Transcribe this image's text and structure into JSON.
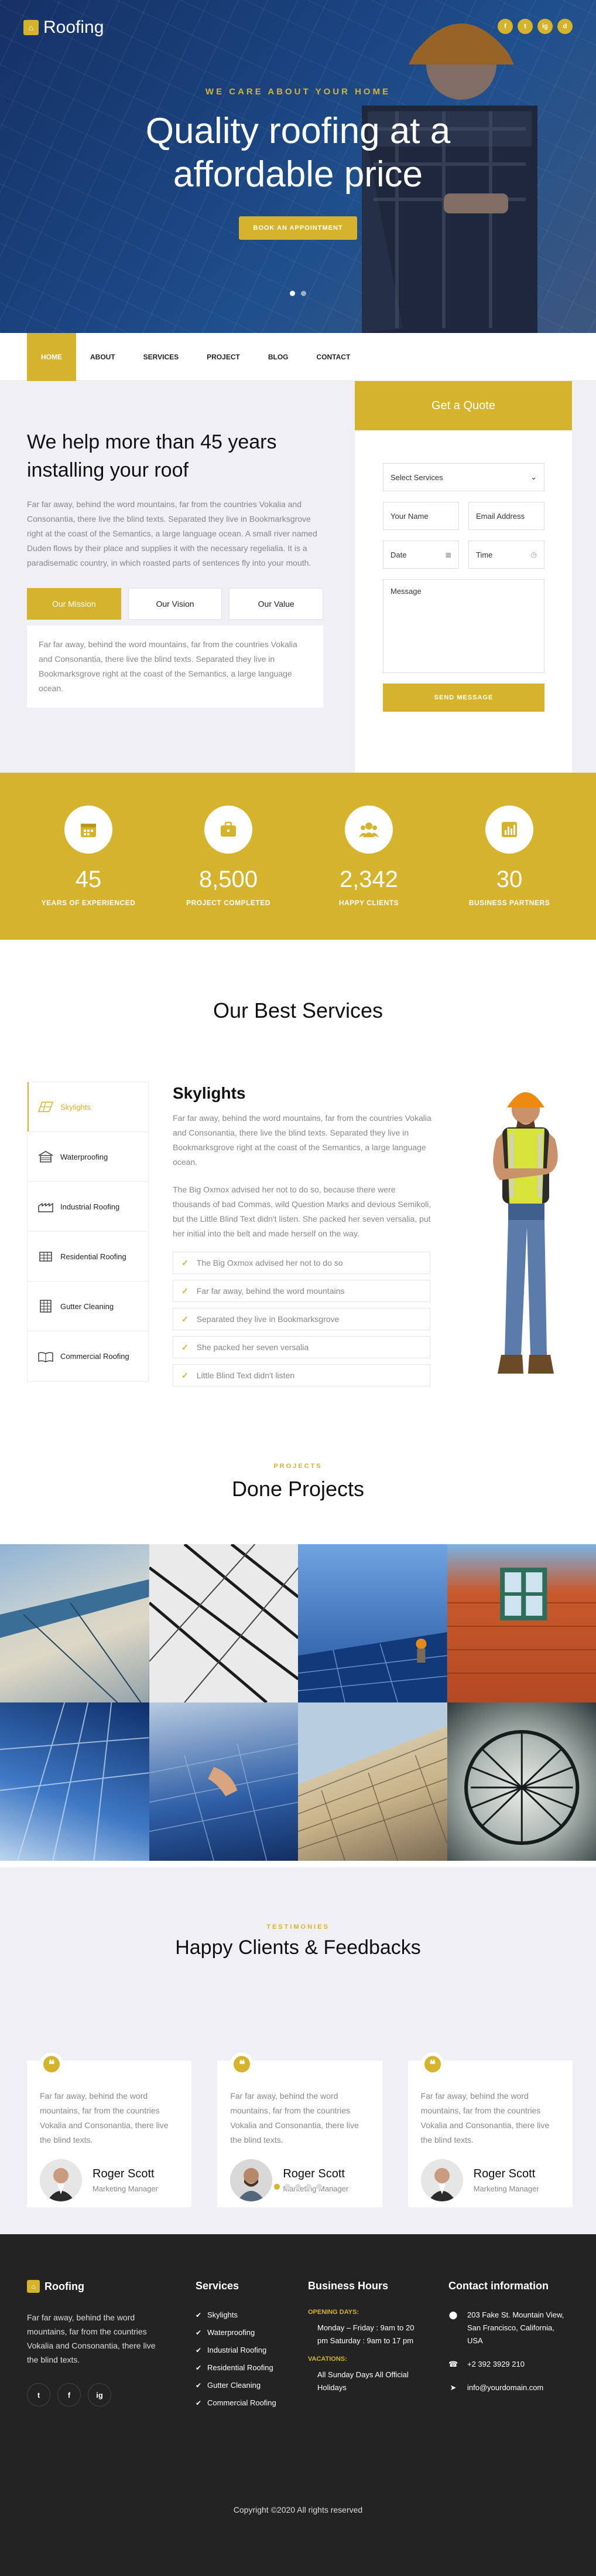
{
  "brand": {
    "name": "Roofing",
    "accent": "#d6b32c",
    "dark": "#232323"
  },
  "hero": {
    "tagline": "WE CARE ABOUT YOUR HOME",
    "title": "Quality roofing at a affordable price",
    "cta": "BOOK AN APPOINTMENT",
    "social": [
      "f",
      "t",
      "ig",
      "d"
    ]
  },
  "nav": {
    "items": [
      "HOME",
      "ABOUT",
      "SERVICES",
      "PROJECT",
      "BLOG",
      "CONTACT"
    ]
  },
  "about": {
    "title": "We help more than 45 years installing your roof",
    "text": "Far far away, behind the word mountains, far from the countries Vokalia and Consonantia, there live the blind texts. Separated they live in Bookmarksgrove right at the coast of the Semantics, a large language ocean. A small river named Duden flows by their place and supplies it with the necessary regelialia. It is a paradisematic country, in which roasted parts of sentences fly into your mouth.",
    "tabs": [
      "Our Mission",
      "Our Vision",
      "Our Value"
    ],
    "tab_text": "Far far away, behind the word mountains, far from the countries Vokalia and Consonantia, there live the blind texts. Separated they live in Bookmarksgrove right at the coast of the Semantics, a large language ocean."
  },
  "quote": {
    "title": "Get a Quote",
    "select": "Select Services",
    "name": "Your Name",
    "email": "Email Address",
    "date": "Date",
    "time": "Time",
    "message": "Message",
    "submit": "SEND MESSAGE"
  },
  "stats": [
    {
      "value": "45",
      "label": "YEARS OF EXPERIENCED",
      "icon": "calendar-icon"
    },
    {
      "value": "8,500",
      "label": "PROJECT COMPLETED",
      "icon": "briefcase-icon"
    },
    {
      "value": "2,342",
      "label": "HAPPY CLIENTS",
      "icon": "users-icon"
    },
    {
      "value": "30",
      "label": "BUSINESS PARTNERS",
      "icon": "chart-icon"
    }
  ],
  "services": {
    "title": "Our Best Services",
    "items": [
      "Skylights",
      "Waterproofing",
      "Industrial Roofing",
      "Residential Roofing",
      "Gutter Cleaning",
      "Commercial Roofing"
    ],
    "heading": "Skylights",
    "p1": "Far far away, behind the word mountains, far from the countries Vokalia and Consonantia, there live the blind texts. Separated they live in Bookmarksgrove right at the coast of the Semantics, a large language ocean.",
    "p2": "The Big Oxmox advised her not to do so, because there were thousands of bad Commas, wild Question Marks and devious Semikoli, but the Little Blind Text didn't listen. She packed her seven versalia, put her initial into the belt and made herself on the way.",
    "checks": [
      "The Big Oxmox advised her not to do so",
      "Far far away, behind the word mountains",
      "Separated they live in Bookmarksgrove",
      "She packed her seven versalia",
      "Little Blind Text didn't listen"
    ]
  },
  "projects": {
    "kicker": "PROJECTS",
    "title": "Done Projects"
  },
  "testimonials": {
    "kicker": "TESTIMONIES",
    "title": "Happy Clients & Feedbacks",
    "items": [
      {
        "text": "Far far away, behind the word mountains, far from the countries Vokalia and Consonantia, there live the blind texts.",
        "name": "Roger Scott",
        "role": "Marketing Manager"
      },
      {
        "text": "Far far away, behind the word mountains, far from the countries Vokalia and Consonantia, there live the blind texts.",
        "name": "Roger Scott",
        "role": "Marketing Manager"
      },
      {
        "text": "Far far away, behind the word mountains, far from the countries Vokalia and Consonantia, there live the blind texts.",
        "name": "Roger Scott",
        "role": "Marketing Manager"
      }
    ]
  },
  "footer": {
    "about": "Far far away, behind the word mountains, far from the countries Vokalia and Consonantia, there live the blind texts.",
    "social": [
      "t",
      "f",
      "ig"
    ],
    "services_title": "Services",
    "services": [
      "Skylights",
      "Waterproofing",
      "Industrial Roofing",
      "Residential Roofing",
      "Gutter Cleaning",
      "Commercial Roofing"
    ],
    "hours_title": "Business Hours",
    "opening_label": "OPENING DAYS:",
    "opening_text": "Monday – Friday : 9am to 20 pm Saturday : 9am to 17 pm",
    "vacation_label": "VACATIONS:",
    "vacation_text": "All Sunday Days All Official Holidays",
    "contact_title": "Contact information",
    "address": "203 Fake St. Mountain View, San Francisco, California, USA",
    "phone": "+2 392 3929 210",
    "email": "info@yourdomain.com",
    "copyright": "Copyright ©2020 All rights reserved"
  }
}
